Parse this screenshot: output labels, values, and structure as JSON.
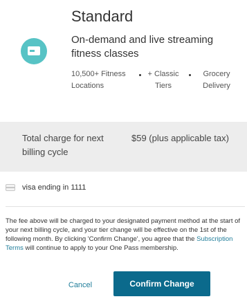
{
  "plan": {
    "title": "Standard",
    "description": "On-demand and live streaming fitness classes",
    "features": [
      "10,500+ Fitness Locations",
      "+ Classic Tiers",
      "Grocery Delivery"
    ]
  },
  "charge": {
    "label": "Total charge for next billing cycle",
    "value": "$59 (plus applicable tax)"
  },
  "payment": {
    "text": "visa ending in 1111",
    "icon": "credit-card-icon"
  },
  "disclaimer": {
    "before_link": "The fee above will be charged to your designated payment method at the start of your next billing cycle, and your tier change will be effective on the 1st of the following month. By clicking 'Confirm Change', you agree that the ",
    "link": "Subscription Terms",
    "after_link": " will continue to apply to your One Pass membership."
  },
  "actions": {
    "cancel_label": "Cancel",
    "confirm_label": "Confirm Change"
  },
  "colors": {
    "plan_icon": "#57c3c5",
    "charge_background": "#ededed",
    "link": "#1f7d9a",
    "primary_button": "#0b6a8c"
  }
}
